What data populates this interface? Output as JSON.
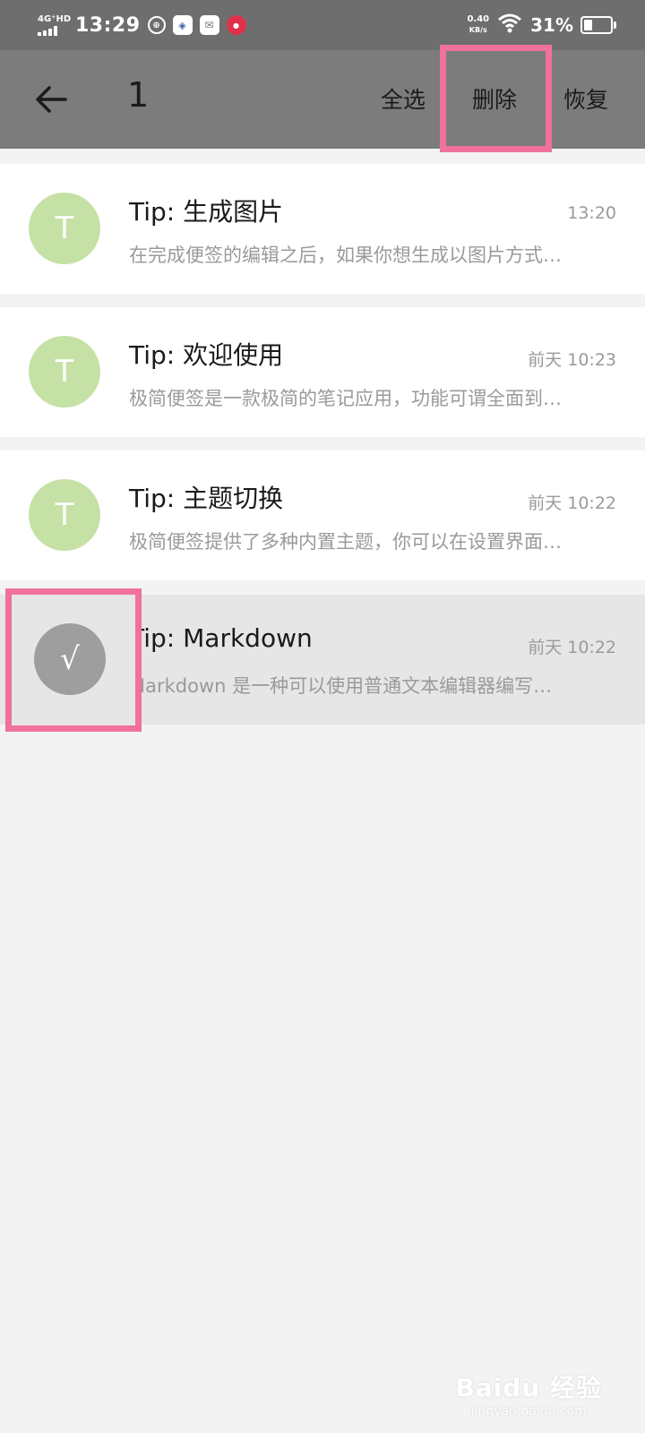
{
  "status_bar": {
    "network": "4G⁺HD",
    "time": "13:29",
    "speed_value": "0.40",
    "speed_unit": "KB/s",
    "battery": "31%",
    "battery_level": 0.31
  },
  "toolbar": {
    "selected_count": "1",
    "select_all": "全选",
    "delete": "删除",
    "restore": "恢复"
  },
  "notes": [
    {
      "avatar": "T",
      "title": "Tip: 生成图片",
      "time": "13:20",
      "preview": "在完成便签的编辑之后，如果你想生成以图片方式…"
    },
    {
      "avatar": "T",
      "title": "Tip: 欢迎使用",
      "time": "前天 10:23",
      "preview": "极简便签是一款极简的笔记应用，功能可谓全面到…"
    },
    {
      "avatar": "T",
      "title": "Tip: 主题切换",
      "time": "前天 10:22",
      "preview": "极简便签提供了多种内置主题，你可以在设置界面…"
    },
    {
      "avatar": "√",
      "title": "Tip: Markdown",
      "time": "前天 10:22",
      "preview": "Markdown 是一种可以使用普通文本编辑器编写…",
      "selected": true
    }
  ],
  "watermark": {
    "main": "Baidu 经验",
    "sub": "jingyan.baidu.com"
  },
  "colors": {
    "toolbar": "#7c7c7c",
    "status_bar": "#6e6e6e",
    "avatar": "#c5e1a5",
    "avatar_checked": "#9e9e9e",
    "highlight": "#f0729a"
  }
}
